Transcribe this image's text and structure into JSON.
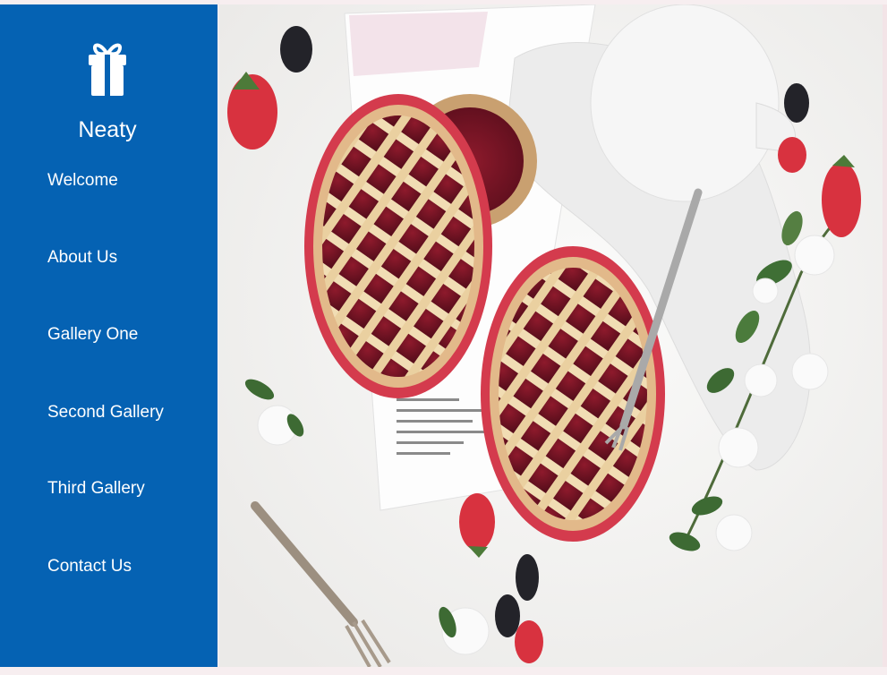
{
  "brand": {
    "name": "Neaty",
    "logo_icon": "gift-icon"
  },
  "nav": {
    "items": [
      {
        "label": "Welcome"
      },
      {
        "label": "About Us"
      },
      {
        "label": "Gallery One"
      },
      {
        "label": "Second Gallery"
      },
      {
        "label": "Third Gallery"
      },
      {
        "label": "Contact Us"
      }
    ]
  },
  "hero": {
    "image_subject": "berry-lattice-pies-photo"
  },
  "colors": {
    "sidebar": "#0562b3",
    "text": "#ffffff",
    "page_background": "#f7eef0"
  }
}
